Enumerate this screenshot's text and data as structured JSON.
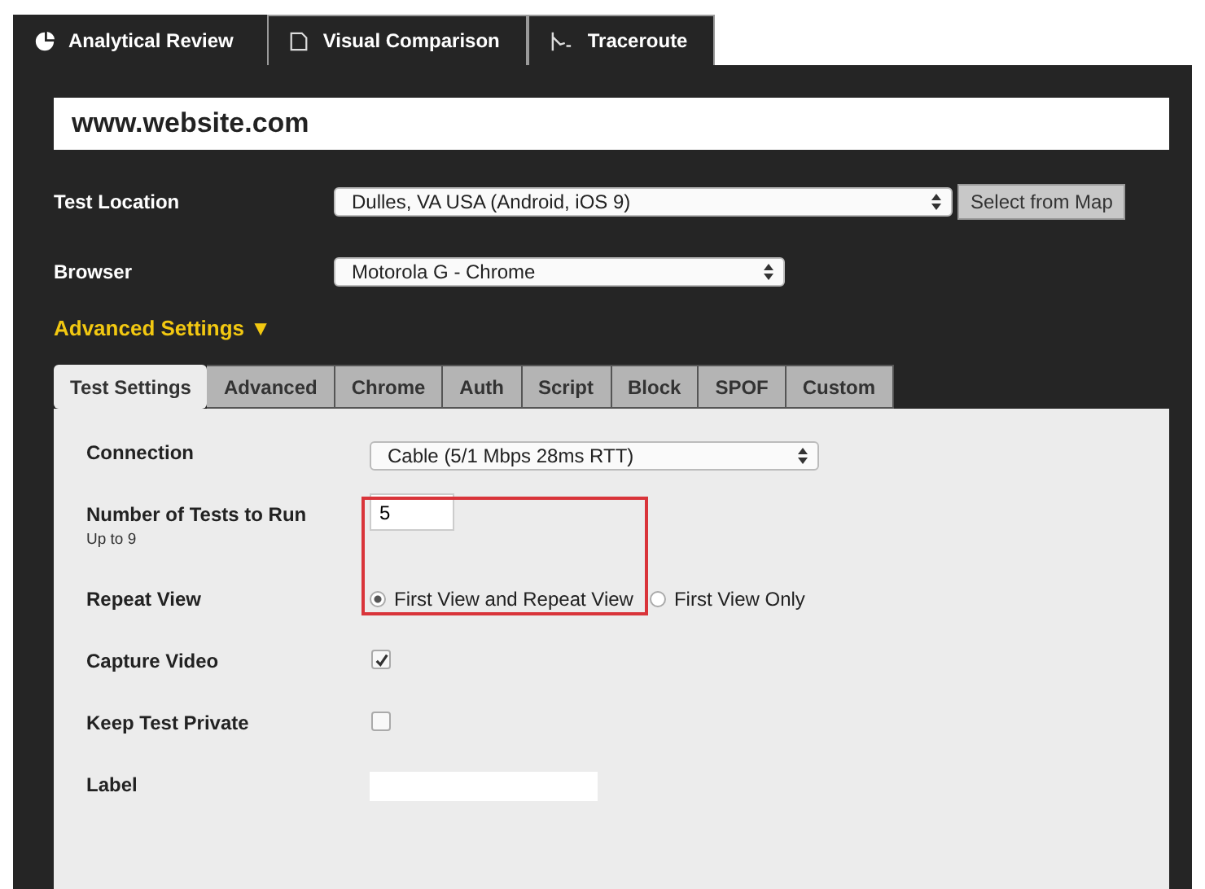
{
  "top_tabs": [
    {
      "label": "Analytical Review",
      "selected": true
    },
    {
      "label": "Visual Comparison",
      "selected": false
    },
    {
      "label": "Traceroute",
      "selected": false
    }
  ],
  "url": {
    "value": "www.website.com"
  },
  "test_location": {
    "label": "Test Location",
    "value": "Dulles, VA USA (Android, iOS 9)",
    "button": "Select from Map"
  },
  "browser": {
    "label": "Browser",
    "value": "Motorola G - Chrome"
  },
  "advanced": {
    "label": "Advanced Settings",
    "icon": "▼",
    "expanded": true
  },
  "settings_tabs": [
    {
      "label": "Test Settings",
      "selected": true
    },
    {
      "label": "Advanced",
      "selected": false
    },
    {
      "label": "Chrome",
      "selected": false
    },
    {
      "label": "Auth",
      "selected": false
    },
    {
      "label": "Script",
      "selected": false
    },
    {
      "label": "Block",
      "selected": false
    },
    {
      "label": "SPOF",
      "selected": false
    },
    {
      "label": "Custom",
      "selected": false
    }
  ],
  "fields": [
    {
      "kind": "select",
      "label": "Connection",
      "value": "Cable (5/1 Mbps 28ms RTT)"
    },
    {
      "kind": "number",
      "label": "Number of Tests to Run",
      "hint": "Up to 9",
      "value": "5",
      "highlighted": true
    },
    {
      "kind": "radio",
      "label": "Repeat View",
      "options": [
        {
          "label": "First View and Repeat View",
          "selected": true
        },
        {
          "label": "First View Only",
          "selected": false
        }
      ]
    },
    {
      "kind": "checkbox",
      "label": "Capture Video",
      "checked": true
    },
    {
      "kind": "checkbox",
      "label": "Keep Test Private",
      "checked": false
    },
    {
      "kind": "text",
      "label": "Label"
    }
  ]
}
